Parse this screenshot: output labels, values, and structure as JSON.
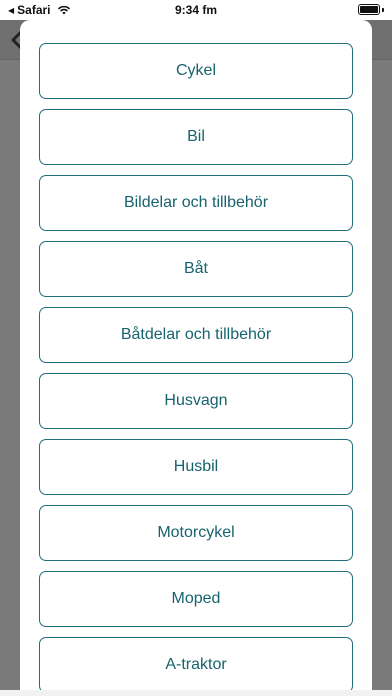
{
  "status_bar": {
    "back_app_label": "Safari",
    "time": "9:34 fm"
  },
  "options": [
    {
      "label": "Cykel"
    },
    {
      "label": "Bil"
    },
    {
      "label": "Bildelar och tillbehör"
    },
    {
      "label": "Båt"
    },
    {
      "label": "Båtdelar och tillbehör"
    },
    {
      "label": "Husvagn"
    },
    {
      "label": "Husbil"
    },
    {
      "label": "Motorcykel"
    },
    {
      "label": "Moped"
    },
    {
      "label": "A-traktor"
    }
  ],
  "colors": {
    "accent": "#17636e",
    "overlay": "#7a7a7a"
  },
  "icons": {
    "status_back": "back-triangle-icon",
    "wifi": "wifi-icon",
    "battery": "battery-icon",
    "header_back": "chevron-left-icon"
  }
}
